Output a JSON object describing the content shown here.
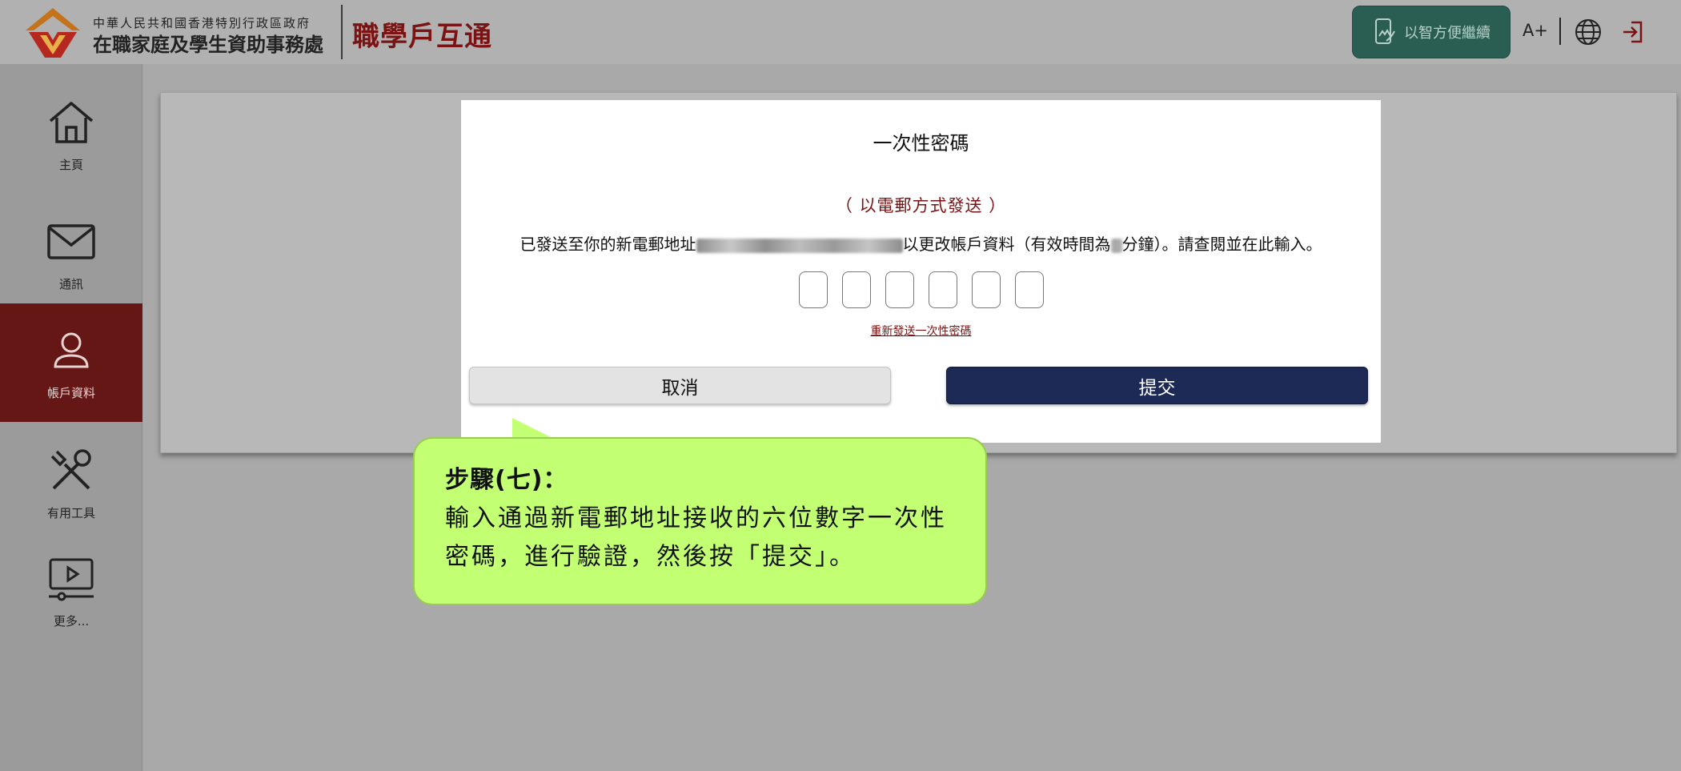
{
  "header": {
    "org_small": "中華人民共和國香港特別行政區政府",
    "org_large": "在職家庭及學生資助事務處",
    "app_title": "職學戶互通",
    "smart_label": "以智方便繼續",
    "font_size_label": "A+"
  },
  "sidebar": {
    "items": [
      {
        "label": "主頁",
        "icon": "home-icon"
      },
      {
        "label": "通訊",
        "icon": "mail-icon"
      },
      {
        "label": "帳戶資料",
        "icon": "user-icon"
      },
      {
        "label": "有用工具",
        "icon": "tools-icon"
      },
      {
        "label": "更多...",
        "icon": "video-icon"
      }
    ]
  },
  "modal": {
    "title": "一次性密碼",
    "subtitle": "（ 以電郵方式發送 ）",
    "message_prefix": "已發送至你的新電郵地址",
    "message_middle": "以更改帳戶資料（有效時間為",
    "message_suffix": "分鐘）。請查閱並在此輸入。",
    "otp_digits": [
      "",
      "",
      "",
      "",
      "",
      ""
    ],
    "resend_label": "重新發送一次性密碼",
    "cancel_label": "取消",
    "submit_label": "提交"
  },
  "callout": {
    "title": "步驟(七)：",
    "body": "輸入通過新電郵地址接收的六位數字一次性密碼，進行驗證，然後按「提交」。"
  },
  "colors": {
    "brand_red": "#7a1313",
    "sidebar_active": "#651715",
    "smart_green": "#2a5e52",
    "submit_navy": "#1e2a56",
    "callout_green": "#c3ff73"
  }
}
